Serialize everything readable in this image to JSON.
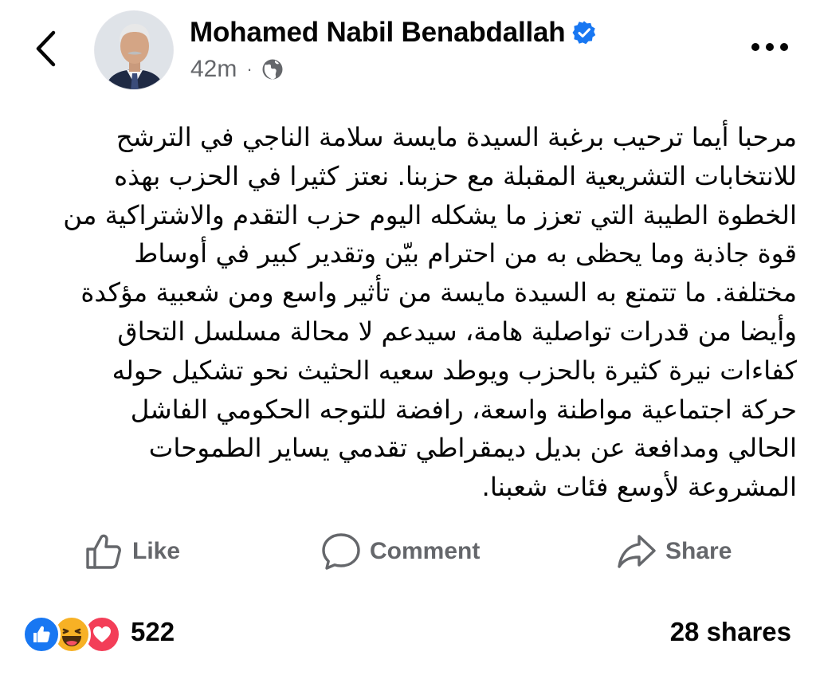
{
  "header": {
    "author_name": "Mohamed Nabil Benabdallah",
    "verified": true,
    "time_ago": "42m",
    "separator": "·",
    "audience_icon": "globe-icon"
  },
  "post": {
    "lines": [
      "مرحبا أيما ترحيب برغبة السيدة مايسة سلامة الناجي في الترشح",
      "للانتخابات التشريعية المقبلة مع حزبنا. نعتز كثيرا في الحزب بهذه",
      "الخطوة الطيبة التي تعزز ما يشكله اليوم حزب التقدم والاشتراكية من",
      "قوة جاذبة وما يحظى به من احترام بيّن وتقدير كبير في أوساط",
      "مختلفة. ما تتمتع به السيدة مايسة من تأثير واسع ومن شعبية مؤكدة",
      "وأيضا من قدرات تواصلية هامة، سيدعم لا محالة مسلسل التحاق",
      "كفاءات نيرة كثيرة بالحزب ويوطد سعيه الحثيث نحو تشكيل حوله",
      "حركة اجتماعية مواطنة واسعة، رافضة للتوجه الحكومي الفاشل",
      "الحالي ومدافعة عن بديل ديمقراطي تقدمي يساير الطموحات",
      "المشروعة لأوسع فئات شعبنا."
    ]
  },
  "actions": {
    "like_label": "Like",
    "comment_label": "Comment",
    "share_label": "Share"
  },
  "stats": {
    "reaction_count": "522",
    "shares_text": "28 shares"
  },
  "colors": {
    "text_primary": "#050505",
    "text_secondary": "#65676b",
    "verified_blue": "#1877f2",
    "like_blue": "#1877f2",
    "haha_yellow": "#f7b125",
    "love_red": "#f33e58"
  }
}
